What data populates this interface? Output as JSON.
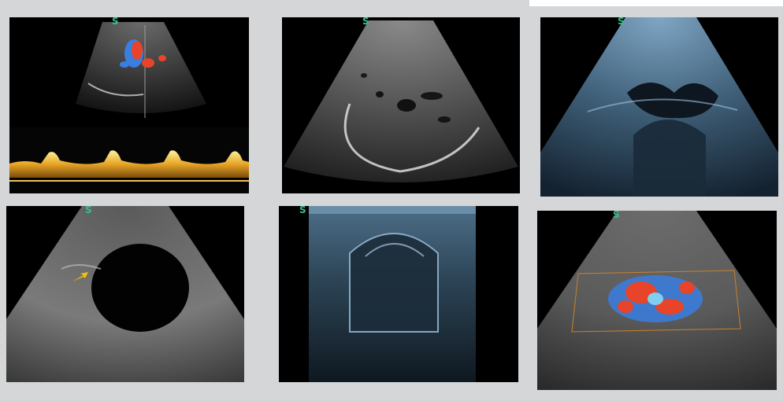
{
  "gallery": {
    "panels": [
      {
        "marker": "S",
        "type": "color-doppler-spectral"
      },
      {
        "marker": "S",
        "type": "grayscale-liver"
      },
      {
        "marker": "S",
        "type": "blue-tint-abdomen"
      },
      {
        "marker": "S",
        "type": "grayscale-cyst"
      },
      {
        "marker": "S",
        "type": "blue-tint-linear"
      },
      {
        "marker": "S",
        "type": "color-doppler-kidney"
      }
    ]
  },
  "colors": {
    "page_background": "#d5d6d8",
    "frame_background": "#000000",
    "marker": "#38c08a",
    "doppler_red": "#e8442a",
    "doppler_blue": "#3a7ee0",
    "spectral_gold": "#e8a626"
  }
}
